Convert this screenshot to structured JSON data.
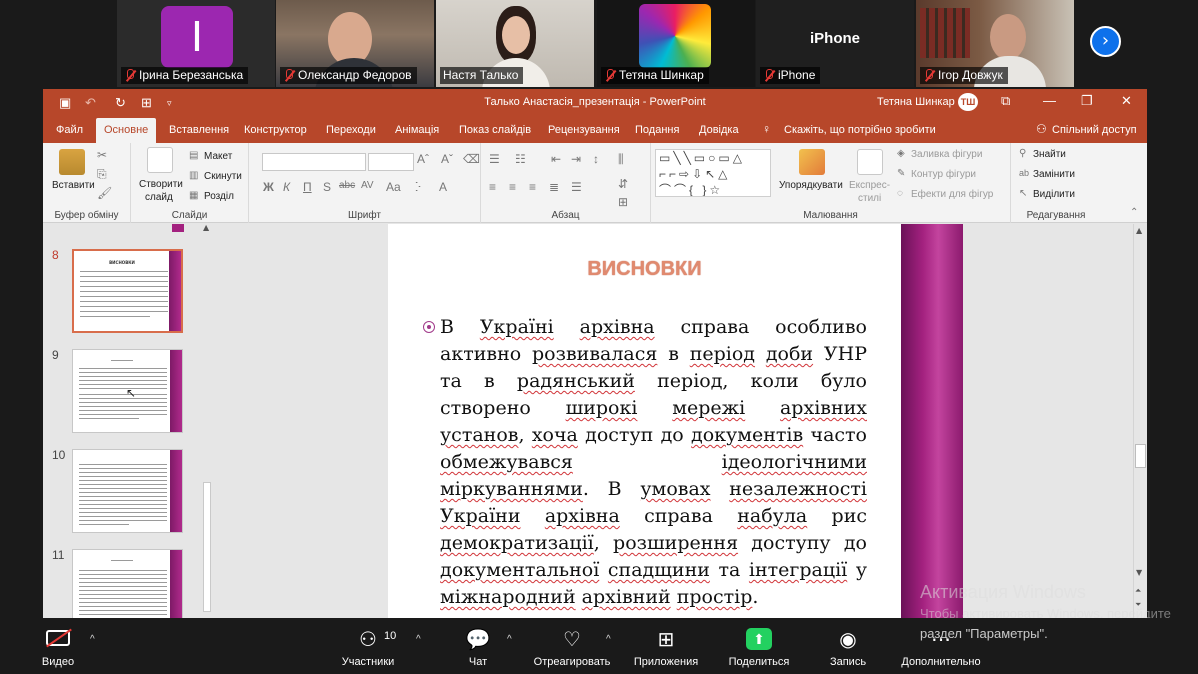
{
  "participants": [
    {
      "name": "Ірина Березанська",
      "avatar_letter": "I",
      "type": "avatar"
    },
    {
      "name": "Олександр Федоров",
      "type": "video"
    },
    {
      "name": "Настя Талько",
      "type": "video",
      "active": true
    },
    {
      "name": "Тетяна Шинкар",
      "type": "video"
    },
    {
      "name": "iPhone",
      "label_center": "iPhone",
      "type": "placeholder"
    },
    {
      "name": "Ігор Довжук",
      "type": "video"
    }
  ],
  "ppt": {
    "window_title": "Талько Анастасія_презентація  -  PowerPoint",
    "user_name": "Тетяна Шинкар",
    "user_initials": "ТШ",
    "tabs": [
      "Файл",
      "Основне",
      "Вставлення",
      "Конструктор",
      "Переходи",
      "Анімація",
      "Показ слайдів",
      "Рецензування",
      "Подання",
      "Довідка"
    ],
    "tell_me": "Скажіть, що потрібно зробити",
    "share": "Спільний доступ",
    "ribbon": {
      "paste": "Вставити",
      "clipboard_group": "Буфер обміну",
      "new_slide": "Створити",
      "new_slide2": "слайд",
      "layout": "Макет",
      "reset": "Скинути",
      "section": "Розділ",
      "slides_group": "Слайди",
      "font_group": "Шрифт",
      "paragraph_group": "Абзац",
      "arrange": "Упорядкувати",
      "quick_styles": "Експрес-",
      "quick_styles2": "стилі",
      "shape_fill": "Заливка фігури",
      "shape_outline": "Контур фігури",
      "shape_effects": "Ефекти для фігур",
      "drawing_group": "Малювання",
      "find": "Знайти",
      "replace": "Замінити",
      "select": "Виділити",
      "editing_group": "Редагування"
    },
    "slide_numbers": [
      "8",
      "9",
      "10",
      "11"
    ],
    "slide": {
      "title": "ВИСНОВКИ",
      "body": [
        {
          "t": "В ",
          "u": false
        },
        {
          "t": "Україні",
          "u": true
        },
        {
          "t": " ",
          "u": false
        },
        {
          "t": "архівна",
          "u": true
        },
        {
          "t": " справа особливо активно ",
          "u": false
        },
        {
          "t": "розвивалася",
          "u": true
        },
        {
          "t": " в ",
          "u": false
        },
        {
          "t": "період",
          "u": true
        },
        {
          "t": " ",
          "u": false
        },
        {
          "t": "доби",
          "u": true
        },
        {
          "t": " УНР та в ",
          "u": false
        },
        {
          "t": "радянський",
          "u": true
        },
        {
          "t": " період, коли було створено ",
          "u": false
        },
        {
          "t": "широкі",
          "u": true
        },
        {
          "t": " ",
          "u": false
        },
        {
          "t": "мережі",
          "u": true
        },
        {
          "t": " ",
          "u": false
        },
        {
          "t": "архівних",
          "u": true
        },
        {
          "t": " ",
          "u": false
        },
        {
          "t": "установ",
          "u": true
        },
        {
          "t": ", ",
          "u": false
        },
        {
          "t": "хоча",
          "u": true
        },
        {
          "t": " доступ до ",
          "u": false
        },
        {
          "t": "документів",
          "u": true
        },
        {
          "t": " часто ",
          "u": false
        },
        {
          "t": "обмежувався",
          "u": true
        },
        {
          "t": " ",
          "u": false
        },
        {
          "t": "ідеологічними",
          "u": true
        },
        {
          "t": " ",
          "u": false
        },
        {
          "t": "міркуваннями",
          "u": true
        },
        {
          "t": ". В ",
          "u": false
        },
        {
          "t": "умовах",
          "u": true
        },
        {
          "t": " ",
          "u": false
        },
        {
          "t": "незалежності",
          "u": true
        },
        {
          "t": " ",
          "u": false
        },
        {
          "t": "України",
          "u": true
        },
        {
          "t": " ",
          "u": false
        },
        {
          "t": "архівна",
          "u": true
        },
        {
          "t": " справа ",
          "u": false
        },
        {
          "t": "набула",
          "u": true
        },
        {
          "t": " рис ",
          "u": false
        },
        {
          "t": "демократизації",
          "u": true
        },
        {
          "t": ", ",
          "u": false
        },
        {
          "t": "розширення",
          "u": true
        },
        {
          "t": " доступу до ",
          "u": false
        },
        {
          "t": "документальної",
          "u": true
        },
        {
          "t": " ",
          "u": false
        },
        {
          "t": "спадщини",
          "u": true
        },
        {
          "t": " та ",
          "u": false
        },
        {
          "t": "інтеграції",
          "u": true
        },
        {
          "t": " у ",
          "u": false
        },
        {
          "t": "міжнародний",
          "u": true
        },
        {
          "t": " ",
          "u": false
        },
        {
          "t": "архівний",
          "u": true
        },
        {
          "t": " ",
          "u": false
        },
        {
          "t": "простір",
          "u": true
        },
        {
          "t": ".",
          "u": false
        }
      ]
    }
  },
  "watermark": {
    "line1": "Активация Windows",
    "line2": "Чтобы активировать Windows, перейдите",
    "line3": "раздел \"Параметры\"."
  },
  "toolbar": {
    "video": "Видео",
    "participants": "Участники",
    "participants_count": "10",
    "chat": "Чат",
    "react": "Отреагировать",
    "apps": "Приложения",
    "share": "Поделиться",
    "record": "Запись",
    "more": "Дополнительно"
  },
  "colors": {
    "ppt_accent": "#b7472a",
    "active_speaker": "#23d160",
    "zoom_blue": "#0e71eb",
    "slide_bar": "#a3217f"
  }
}
